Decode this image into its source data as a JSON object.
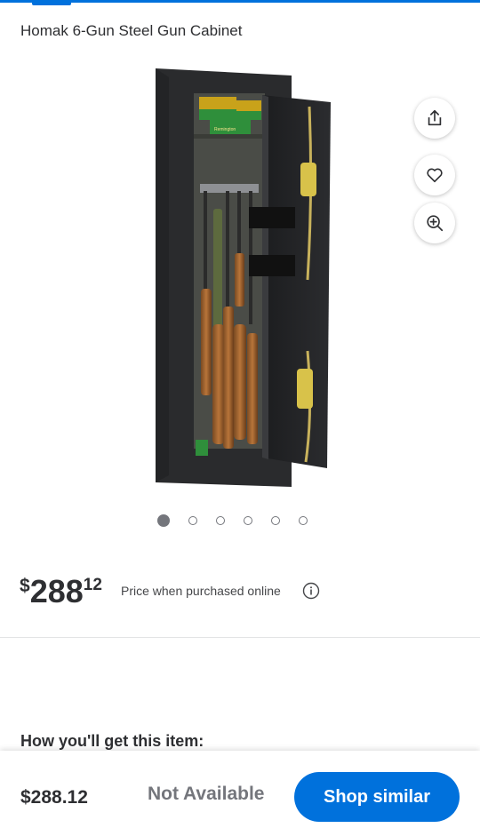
{
  "product": {
    "title": "Homak 6-Gun Steel Gun Cabinet"
  },
  "image": {
    "carousel_count": 6,
    "active_index": 0,
    "box_label": "Remington"
  },
  "actions": {
    "share_icon": "share-icon",
    "favorite_icon": "heart-icon",
    "zoom_icon": "zoom-in-icon"
  },
  "price": {
    "currency": "$",
    "whole": "288",
    "cents": "12",
    "note": "Price when purchased online"
  },
  "fulfillment": {
    "heading": "How you'll get this item:"
  },
  "bottom_bar": {
    "price": "$288.12",
    "status": "Not Available",
    "cta_label": "Shop similar"
  },
  "colors": {
    "accent": "#0071dc",
    "text": "#2e2f32",
    "muted": "#74767c"
  }
}
